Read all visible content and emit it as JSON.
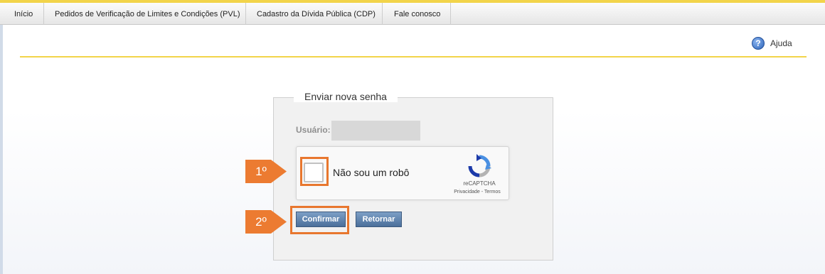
{
  "nav": {
    "items": [
      {
        "label": "Início"
      },
      {
        "label": "Pedidos de Verificação de Limites e Condições (PVL)"
      },
      {
        "label": "Cadastro da Dívida Pública (CDP)"
      },
      {
        "label": "Fale conosco"
      }
    ]
  },
  "help": {
    "icon": "question-circle-icon",
    "label": "Ajuda"
  },
  "form": {
    "legend": "Enviar nova senha",
    "user_label": "Usuário:",
    "user_value": ""
  },
  "recaptcha": {
    "checkbox_label": "Não sou um robô",
    "brand": "reCAPTCHA",
    "links": "Privacidade - Termos",
    "logo_icon": "recaptcha-logo-icon"
  },
  "buttons": {
    "confirm": "Confirmar",
    "return": "Retornar"
  },
  "annotations": {
    "step1": "1º",
    "step2": "2º",
    "color": "#ec7b31"
  },
  "colors": {
    "accent_yellow": "#f2d44a",
    "button_blue": "#4b6f9b",
    "highlight_orange": "#e8772e"
  }
}
